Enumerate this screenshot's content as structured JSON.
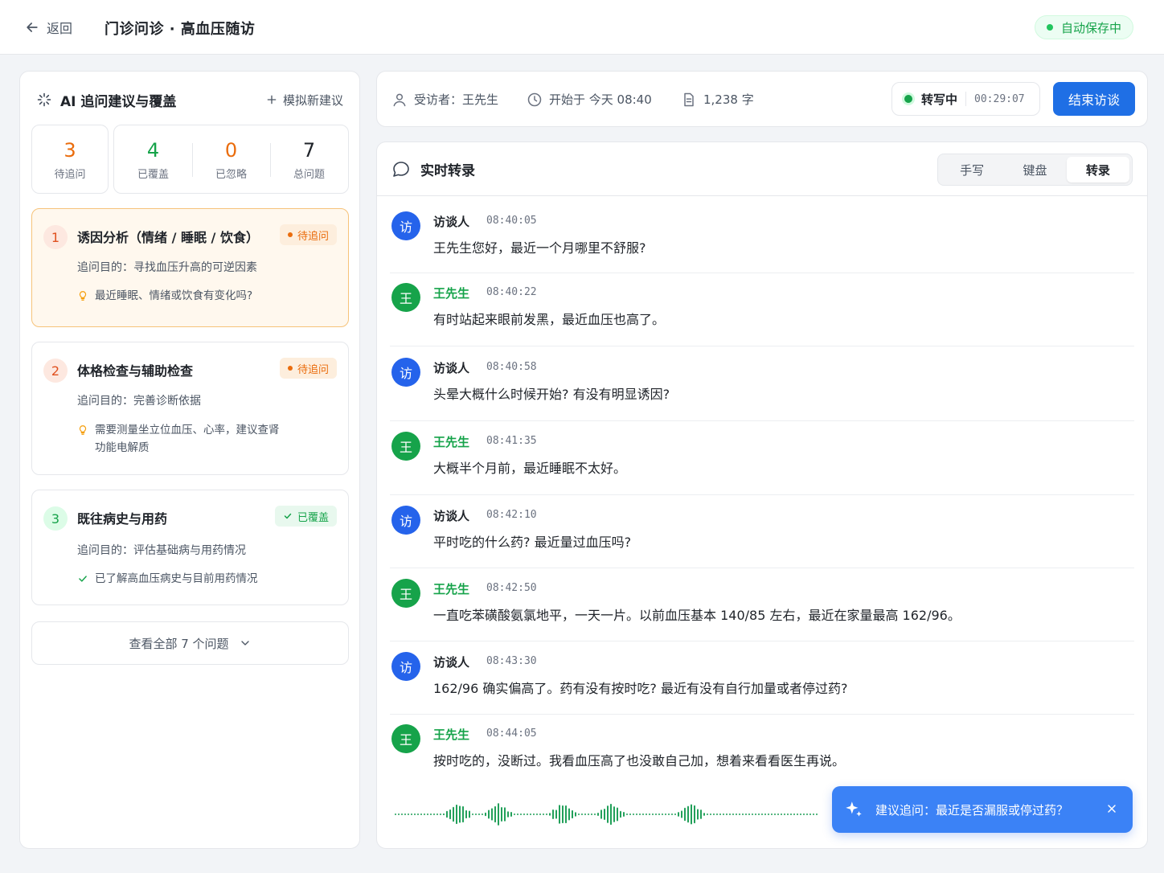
{
  "header": {
    "back_label": "返回",
    "title": "门诊问诊 · 高血压随访",
    "autosave": "自动保存中"
  },
  "left": {
    "title": "AI 追问建议与覆盖",
    "simulate_label": "模拟新建议",
    "stats": [
      {
        "num": "3",
        "label": "待追问",
        "color": "#ea6c0c"
      },
      {
        "num": "4",
        "label": "已覆盖",
        "color": "#16a34a"
      },
      {
        "num": "0",
        "label": "已忽略",
        "color": "#ea6c0c"
      },
      {
        "num": "7",
        "label": "总问题",
        "color": "#1f2329"
      }
    ],
    "cards": [
      {
        "index": "1",
        "title": "诱因分析（情绪 / 睡眠 / 饮食）",
        "badge": "待追问",
        "purpose": "追问目的：寻找血压升高的可逆因素",
        "hint": "最近睡眠、情绪或饮食有变化吗?"
      },
      {
        "index": "2",
        "title": "体格检查与辅助检查",
        "badge": "待追问",
        "purpose": "追问目的：完善诊断依据",
        "hint": "需要测量坐立位血压、心率，建议查肾功能电解质"
      },
      {
        "index": "3",
        "title": "既往病史与用药",
        "badge": "已覆盖",
        "purpose": "追问目的：评估基础病与用药情况",
        "hint": "已了解高血压病史与目前用药情况"
      }
    ],
    "view_all": "查看全部 7 个问题"
  },
  "info": {
    "interviewee": "受访者：王先生",
    "started": "开始于  今天 08:40",
    "words": "1,238 字",
    "rec_label": "转写中",
    "rec_time": "00:29:07",
    "end_label": "结束访谈"
  },
  "transcript": {
    "title": "实时转录",
    "tabs": [
      "手写",
      "键盘",
      "转录"
    ],
    "messages": [
      {
        "avatar": "访",
        "speaker": "访谈人",
        "time": "08:40:05",
        "text": "王先生您好，最近一个月哪里不舒服?"
      },
      {
        "avatar": "王",
        "speaker": "王先生",
        "time": "08:40:22",
        "text": "有时站起来眼前发黑，最近血压也高了。"
      },
      {
        "avatar": "访",
        "speaker": "访谈人",
        "time": "08:40:58",
        "text": "头晕大概什么时候开始? 有没有明显诱因?"
      },
      {
        "avatar": "王",
        "speaker": "王先生",
        "time": "08:41:35",
        "text": "大概半个月前，最近睡眠不太好。"
      },
      {
        "avatar": "访",
        "speaker": "访谈人",
        "time": "08:42:10",
        "text": "平时吃的什么药? 最近量过血压吗?"
      },
      {
        "avatar": "王",
        "speaker": "王先生",
        "time": "08:42:50",
        "text": "一直吃苯磺酸氨氯地平，一天一片。以前血压基本 140/85 左右，最近在家量最高 162/96。"
      },
      {
        "avatar": "访",
        "speaker": "访谈人",
        "time": "08:43:30",
        "text": "162/96 确实偏高了。药有没有按时吃? 最近有没有自行加量或者停过药?"
      },
      {
        "avatar": "王",
        "speaker": "王先生",
        "time": "08:44:05",
        "text": "按时吃的，没断过。我看血压高了也没敢自己加，想着来看看医生再说。"
      }
    ],
    "suggestion": "建议追问：最近是否漏服或停过药？"
  },
  "colors": {
    "accent": "#1f6fe5",
    "green": "#16a34a",
    "orange": "#ea6c0c"
  }
}
